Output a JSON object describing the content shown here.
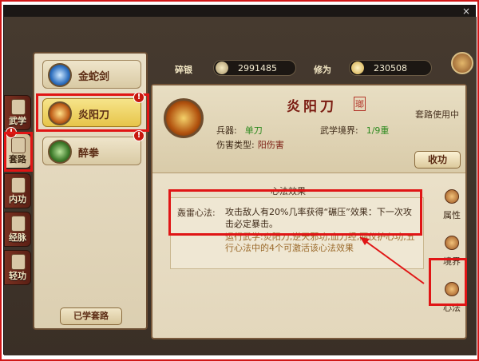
{
  "window": {
    "close_label": "×"
  },
  "left_tabs": [
    {
      "label": "武学"
    },
    {
      "label": "套路"
    },
    {
      "label": "内功"
    },
    {
      "label": "经脉"
    },
    {
      "label": "轻功"
    }
  ],
  "alert_mark": "!",
  "skills": [
    {
      "name": "金蛇剑"
    },
    {
      "name": "炎阳刀"
    },
    {
      "name": "醉拳"
    }
  ],
  "learned_button": "已学套路",
  "currency": {
    "silver_label": "碎银",
    "silver_value": "2991485",
    "cultivation_label": "修为",
    "cultivation_value": "230508"
  },
  "detail": {
    "title": "炎阳刀",
    "seal": "瑯",
    "status": "套路使用中",
    "weapon_label": "兵器:",
    "weapon_value": "单刀",
    "realm_label": "武学境界:",
    "realm_value": "1/9重",
    "damage_label": "伤害类型:",
    "damage_value": "阳伤害",
    "collect_button": "收功"
  },
  "effect": {
    "section_title": "心法效果",
    "name": "轰雷心法:",
    "desc": "攻击敌人有20%几率获得“碾压”效果：下一次攻击必定暴击。",
    "requirement": "运行武学:炎阳刀,逆天邪功,血刀经,两仪护心功,五行心法中的4个可激活该心法效果"
  },
  "right_tabs": [
    {
      "label": "属性"
    },
    {
      "label": "境界"
    },
    {
      "label": "心法"
    }
  ],
  "colors": {
    "highlight": "#e01515",
    "selected_skill": "#f0d468",
    "panel": "#e9dfc7"
  }
}
